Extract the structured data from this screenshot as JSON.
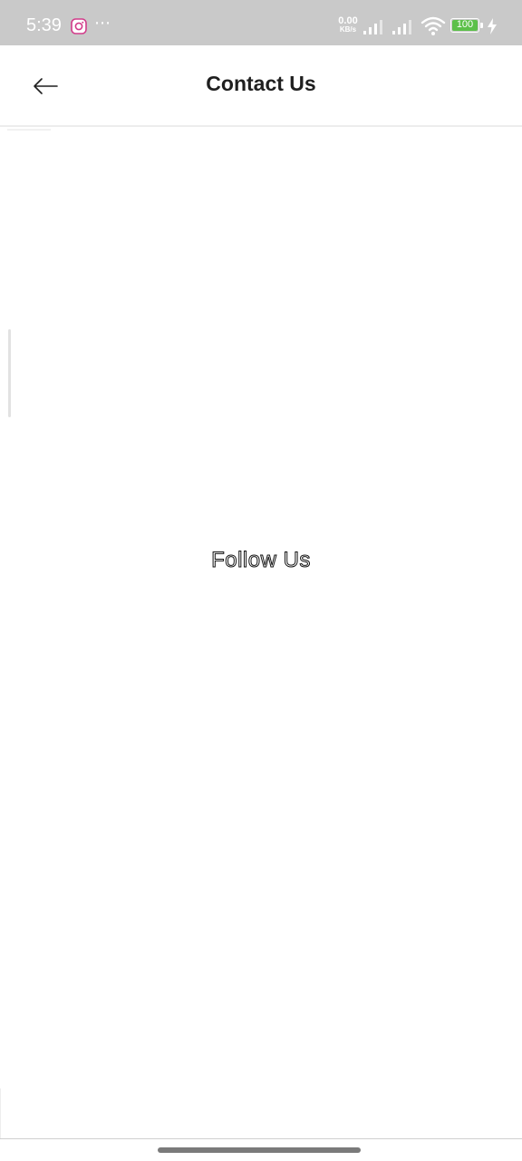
{
  "status_bar": {
    "time": "5:39",
    "more_indicator": "⋯",
    "net_speed_value": "0.00",
    "net_speed_unit": "KB/s",
    "battery_level": "100",
    "notification_icon": "instagram-icon",
    "background_color": "#c9c9c9",
    "battery_color": "#5cc04a"
  },
  "header": {
    "back_icon": "arrow-left-icon",
    "title": "Contact Us"
  },
  "main": {
    "follow_heading": "Follow Us"
  }
}
